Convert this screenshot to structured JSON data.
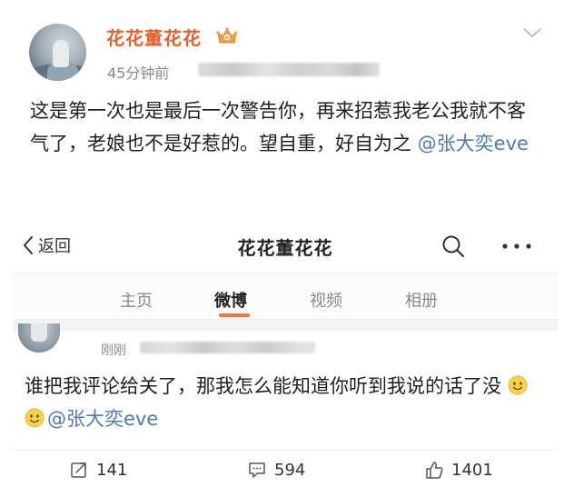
{
  "post_top": {
    "nickname": "花花董花花",
    "badge_icon": "vip-crown-icon",
    "time": "45分钟前",
    "content": "这是第一次也是最后一次警告你，再来招惹我老公我就不客气了，老娘也不是好惹的。望自重，好自为之",
    "mention": "@张大奕eve",
    "colors": {
      "nickname": "#e8602b",
      "mention": "#4f7ab8"
    }
  },
  "navbar": {
    "back_label": "返回",
    "title": "花花董花花",
    "search_icon": "search-icon",
    "more_icon": "more-icon"
  },
  "tabs": [
    {
      "label": "主页",
      "active": false
    },
    {
      "label": "微博",
      "active": true
    },
    {
      "label": "视频",
      "active": false
    },
    {
      "label": "相册",
      "active": false
    }
  ],
  "post_bottom": {
    "time": "刚刚",
    "content": "谁把我评论给关了，那我怎么能知道你听到我说的话了没",
    "emoji_icon": "smile-emoji-icon",
    "mention": "@张大奕eve"
  },
  "actions": {
    "repost_count": "141",
    "comment_count": "594",
    "like_count": "1401"
  },
  "accent_color": "#f7753d"
}
